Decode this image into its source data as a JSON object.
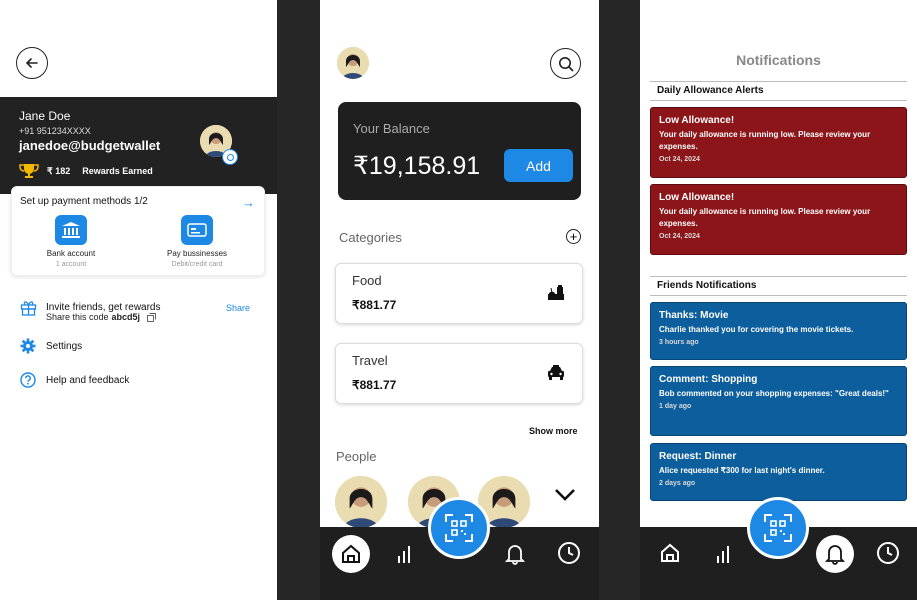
{
  "profile": {
    "name": "Jane Doe",
    "phone": "+91 951234XXXX",
    "email": "janedoe@budgetwallet",
    "rewards_amount": "₹ 182",
    "rewards_label": "Rewards Earned",
    "setup_title": "Set up payment methods 1/2",
    "payment_options": [
      {
        "label": "Bank account",
        "sub": "1 account"
      },
      {
        "label": "Pay bussinesses",
        "sub": "Debit/credit card"
      }
    ],
    "invite_label": "Invite friends, get rewards",
    "share_code_prefix": "Share this code",
    "share_code": "abcd5j",
    "share_label": "Share",
    "settings_label": "Settings",
    "help_label": "Help and feedback"
  },
  "home": {
    "balance_label": "Your Balance",
    "balance_value": "₹19,158.91",
    "add_label": "Add",
    "categories_title": "Categories",
    "categories": [
      {
        "name": "Food",
        "value": "₹881.77",
        "icon": "food-icon"
      },
      {
        "name": "Travel",
        "value": "₹881.77",
        "icon": "car-icon"
      }
    ],
    "show_more": "Show more",
    "people_title": "People"
  },
  "notifications": {
    "title": "Notifications",
    "section1": "Daily Allowance Alerts",
    "alerts": [
      {
        "title": "Low Allowance!",
        "body": "Your daily allowance is running low. Please review your expenses.",
        "time": "Oct 24, 2024"
      },
      {
        "title": "Low Allowance!",
        "body": "Your daily allowance is running low. Please review your expenses.",
        "time": "Oct 24, 2024"
      }
    ],
    "section2": "Friends Notifications",
    "friends": [
      {
        "title": "Thanks: Movie",
        "body": "Charlie thanked you for covering the movie tickets.",
        "time": "3 hours ago"
      },
      {
        "title": "Comment: Shopping",
        "body": "Bob commented on your shopping expenses: \"Great deals!\"",
        "time": "1 day ago"
      },
      {
        "title": "Request: Dinner",
        "body": "Alice requested ₹300 for last night's dinner.",
        "time": "2 days ago"
      }
    ]
  },
  "colors": {
    "accent": "#1e88e5",
    "alert_red": "#8b1518",
    "notif_blue": "#0d5e9c",
    "dark": "#1f1f1f"
  }
}
